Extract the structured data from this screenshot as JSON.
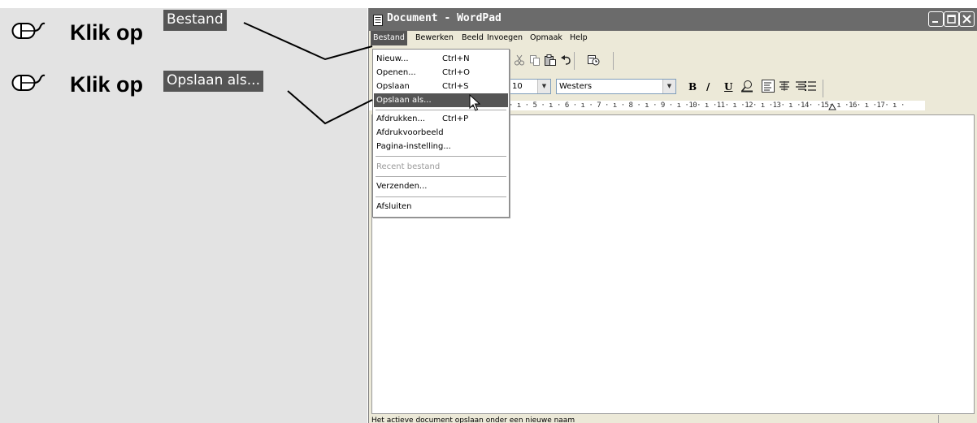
{
  "instructions": {
    "steps": [
      {
        "text": "Klik op",
        "target": "Bestand",
        "icon": "mouse-icon"
      },
      {
        "text": "Klik op",
        "target": "Opslaan als...",
        "icon": "mouse-icon"
      }
    ]
  },
  "window": {
    "title": "Document - WordPad",
    "icon": "wordpad-icon",
    "controls": [
      "minimize-icon",
      "maximize-icon",
      "close-icon"
    ]
  },
  "menubar": {
    "items": [
      "Bestand",
      "Bewerken",
      "Beeld",
      "Invoegen",
      "Opmaak",
      "Help"
    ],
    "open_item": "Bestand"
  },
  "toolbar": {
    "icons": [
      "cut-icon",
      "copy-icon",
      "paste-icon",
      "undo-icon",
      "date-time-icon"
    ]
  },
  "format_bar": {
    "font_size": "10",
    "script": "Westers",
    "buttons": [
      "B",
      "/",
      "U"
    ],
    "icons": [
      "color-icon",
      "align-left-icon",
      "align-center-icon",
      "align-right-icon",
      "bullets-icon"
    ]
  },
  "ruler": {
    "text": "· ı · 5 · ı · 6 · ı · 7 · ı · 8 · ı · 9 · ı ·10· ı ·11· ı ·12· ı ·13· ı ·14·   ·15· ı ·16· ı ·17· ı ·"
  },
  "file_menu": {
    "items": [
      {
        "label": "Nieuw...",
        "shortcut": "Ctrl+N",
        "state": "normal"
      },
      {
        "label": "Openen...",
        "shortcut": "Ctrl+O",
        "state": "normal"
      },
      {
        "label": "Opslaan",
        "shortcut": "Ctrl+S",
        "state": "normal"
      },
      {
        "label": "Opslaan als...",
        "shortcut": "",
        "state": "highlighted"
      },
      {
        "label": "Afdrukken...",
        "shortcut": "Ctrl+P",
        "state": "normal"
      },
      {
        "label": "Afdrukvoorbeeld",
        "shortcut": "",
        "state": "normal"
      },
      {
        "label": "Pagina-instelling...",
        "shortcut": "",
        "state": "normal"
      },
      {
        "label": "Recent bestand",
        "shortcut": "",
        "state": "disabled"
      },
      {
        "label": "Verzenden...",
        "shortcut": "",
        "state": "normal"
      },
      {
        "label": "Afsluiten",
        "shortcut": "",
        "state": "normal"
      }
    ]
  },
  "status_bar": {
    "text": "Het actieve document opslaan onder een nieuwe naam"
  },
  "colors": {
    "highlight": "#555555",
    "panel": "#e3e3e3",
    "titlebar": "#6b6b6b"
  }
}
